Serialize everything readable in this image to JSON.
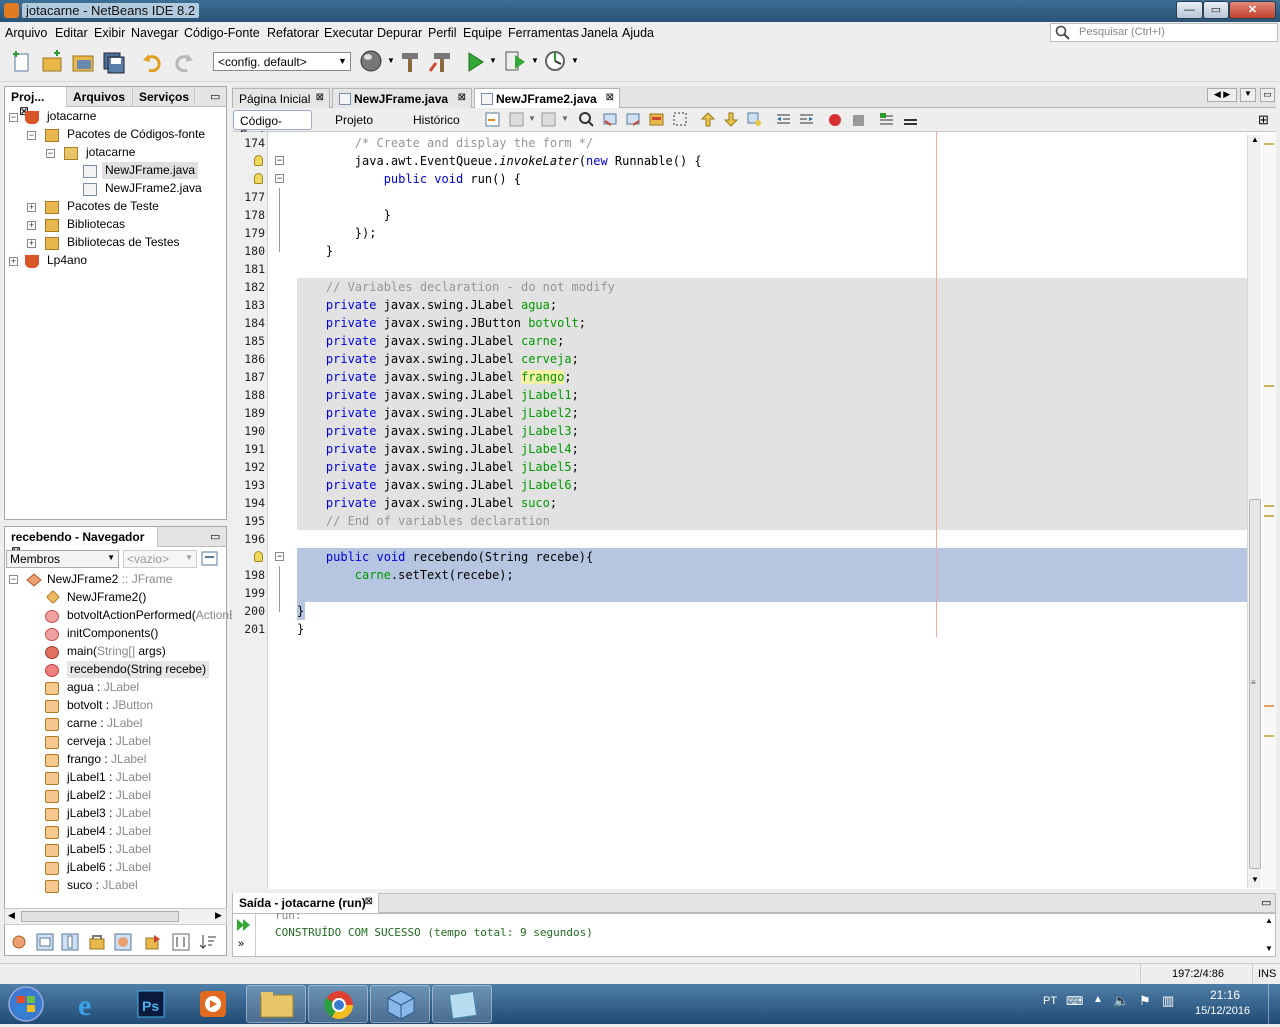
{
  "window": {
    "title": "jotacarne - NetBeans IDE 8.2",
    "minimize": "—",
    "maximize": "▭",
    "close": "✕"
  },
  "menu": {
    "items": [
      "Arquivo",
      "Editar",
      "Exibir",
      "Navegar",
      "Código-Fonte",
      "Refatorar",
      "Executar",
      "Depurar",
      "Perfil",
      "Equipe",
      "Ferramentas",
      "Janela",
      "Ajuda"
    ],
    "search_placeholder": "Pesquisar (Ctrl+I)"
  },
  "toolbar": {
    "config": "<config. default>"
  },
  "projects_panel": {
    "tabs": [
      "Proj...",
      "Arquivos",
      "Serviços"
    ],
    "tree": [
      {
        "label": "jotacarne",
        "icon": "project-icon"
      },
      {
        "label": "Pacotes de Códigos-fonte",
        "icon": "source-packages-icon"
      },
      {
        "label": "jotacarne",
        "icon": "package-icon"
      },
      {
        "label": "NewJFrame.java",
        "icon": "java-file-icon"
      },
      {
        "label": "NewJFrame2.java",
        "icon": "java-file-icon"
      },
      {
        "label": "Pacotes de Teste",
        "icon": "test-packages-icon"
      },
      {
        "label": "Bibliotecas",
        "icon": "libraries-icon"
      },
      {
        "label": "Bibliotecas de Testes",
        "icon": "test-libraries-icon"
      },
      {
        "label": "Lp4ano",
        "icon": "project-icon"
      }
    ]
  },
  "navigator": {
    "title": "recebendo - Navegador",
    "filter": "Membros",
    "filter2": "<vazio>",
    "root": {
      "name": "NewJFrame2",
      "type": ":: JFrame"
    },
    "members": [
      {
        "name": "NewJFrame2()",
        "type": ""
      },
      {
        "name": "botvoltActionPerformed(",
        "type": "ActionEv"
      },
      {
        "name": "initComponents()",
        "type": ""
      },
      {
        "name": "main(",
        "type": "String[]",
        "rest": " args)"
      },
      {
        "name": "recebendo(String recebe)",
        "type": ""
      },
      {
        "name": "agua : ",
        "type": "JLabel"
      },
      {
        "name": "botvolt : ",
        "type": "JButton"
      },
      {
        "name": "carne : ",
        "type": "JLabel"
      },
      {
        "name": "cerveja : ",
        "type": "JLabel"
      },
      {
        "name": "frango : ",
        "type": "JLabel"
      },
      {
        "name": "jLabel1 : ",
        "type": "JLabel"
      },
      {
        "name": "jLabel2 : ",
        "type": "JLabel"
      },
      {
        "name": "jLabel3 : ",
        "type": "JLabel"
      },
      {
        "name": "jLabel4 : ",
        "type": "JLabel"
      },
      {
        "name": "jLabel5 : ",
        "type": "JLabel"
      },
      {
        "name": "jLabel6 : ",
        "type": "JLabel"
      },
      {
        "name": "suco : ",
        "type": "JLabel"
      }
    ]
  },
  "editor": {
    "tabs": [
      "Página Inicial",
      "NewJFrame.java",
      "NewJFrame2.java"
    ],
    "views": [
      "Código-Fonte",
      "Projeto",
      "Histórico"
    ],
    "lines": [
      {
        "n": "174",
        "html": "        <span class='cm'>/* Create and display the form */</span>"
      },
      {
        "n": "",
        "html": "        java.awt.EventQueue.<span class='it'>invokeLater</span>(<span class='kw'>new</span> Runnable() {"
      },
      {
        "n": "",
        "html": "            <span class='kw'>public</span> <span class='kw'>void</span> run() {"
      },
      {
        "n": "177",
        "html": ""
      },
      {
        "n": "178",
        "html": "            }"
      },
      {
        "n": "179",
        "html": "        });"
      },
      {
        "n": "180",
        "html": "    }"
      },
      {
        "n": "181",
        "html": ""
      },
      {
        "n": "182",
        "html": "    <span class='cm'>// Variables declaration - do not modify</span>"
      },
      {
        "n": "183",
        "html": "    <span class='kw'>private</span> javax.swing.JLabel <span class='fld'>agua</span>;"
      },
      {
        "n": "184",
        "html": "    <span class='kw'>private</span> javax.swing.JButton <span class='fld'>botvolt</span>;"
      },
      {
        "n": "185",
        "html": "    <span class='kw'>private</span> javax.swing.JLabel <span class='fld'>carne</span>;"
      },
      {
        "n": "186",
        "html": "    <span class='kw'>private</span> javax.swing.JLabel <span class='fld'>cerveja</span>;"
      },
      {
        "n": "187",
        "html": "    <span class='kw'>private</span> javax.swing.JLabel <span class='fld' style='background:#f4f0a8'>frango</span>;"
      },
      {
        "n": "188",
        "html": "    <span class='kw'>private</span> javax.swing.JLabel <span class='fld'>jLabel1</span>;"
      },
      {
        "n": "189",
        "html": "    <span class='kw'>private</span> javax.swing.JLabel <span class='fld'>jLabel2</span>;"
      },
      {
        "n": "190",
        "html": "    <span class='kw'>private</span> javax.swing.JLabel <span class='fld'>jLabel3</span>;"
      },
      {
        "n": "191",
        "html": "    <span class='kw'>private</span> javax.swing.JLabel <span class='fld'>jLabel4</span>;"
      },
      {
        "n": "192",
        "html": "    <span class='kw'>private</span> javax.swing.JLabel <span class='fld'>jLabel5</span>;"
      },
      {
        "n": "193",
        "html": "    <span class='kw'>private</span> javax.swing.JLabel <span class='fld'>jLabel6</span>;"
      },
      {
        "n": "194",
        "html": "    <span class='kw'>private</span> javax.swing.JLabel <span class='fld'>suco</span>;"
      },
      {
        "n": "195",
        "html": "    <span class='cm'>// End of variables declaration</span>"
      },
      {
        "n": "196",
        "html": ""
      },
      {
        "n": "",
        "html": "    <span class='kw'>public</span> <span class='kw'>void</span> recebendo(String recebe){"
      },
      {
        "n": "198",
        "html": "        <span class='fld'>carne</span>.setText(recebe);"
      },
      {
        "n": "199",
        "html": ""
      },
      {
        "n": "200",
        "html": "}"
      },
      {
        "n": "201",
        "html": "}"
      }
    ]
  },
  "output": {
    "title": "Saída - jotacarne (run)",
    "lines": [
      "run:",
      "CONSTRUÍDO COM SUCESSO (tempo total: 9 segundos)"
    ]
  },
  "status": {
    "position": "197:2/4:86",
    "mode": "INS"
  },
  "taskbar": {
    "lang": "PT",
    "time": "21:16",
    "date": "15/12/2016"
  }
}
